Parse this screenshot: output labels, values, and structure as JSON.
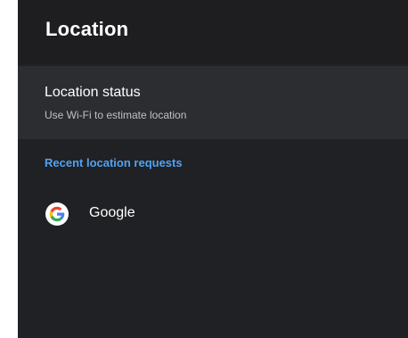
{
  "header": {
    "title": "Location"
  },
  "location_status": {
    "title": "Location status",
    "subtitle": "Use Wi-Fi to estimate location"
  },
  "recent_requests": {
    "header": "Recent location requests",
    "apps": [
      {
        "label": "Google",
        "icon": "google-icon"
      }
    ]
  },
  "colors": {
    "background": "#202124",
    "header_background": "#1e1e20",
    "selected_row": "#2c2d30",
    "accent": "#4ea3f5"
  }
}
